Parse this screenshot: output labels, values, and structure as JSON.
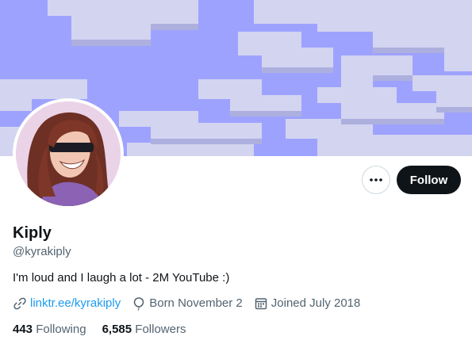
{
  "colors": {
    "banner_sky": "#9ea2ff",
    "block_light": "#d2d3ee",
    "block_shadow": "#a9abd8",
    "follow_bg": "#0f1419",
    "link": "#1d9bf0",
    "secondary_text": "#536471"
  },
  "profile": {
    "name": "Kiply",
    "handle": "@kyrakiply",
    "bio": "I'm loud and I laugh a lot - 2M YouTube :)",
    "website": "linktr.ee/kyrakiply",
    "birthday": "Born November 2",
    "joined": "Joined July 2018"
  },
  "actions": {
    "more_icon": "ellipsis-icon",
    "follow_label": "Follow"
  },
  "stats": {
    "following_count": "443",
    "following_label": "Following",
    "followers_count": "6,585",
    "followers_label": "Followers"
  },
  "icons": {
    "website": "link-icon",
    "birthday": "balloon-icon",
    "joined": "calendar-icon"
  }
}
